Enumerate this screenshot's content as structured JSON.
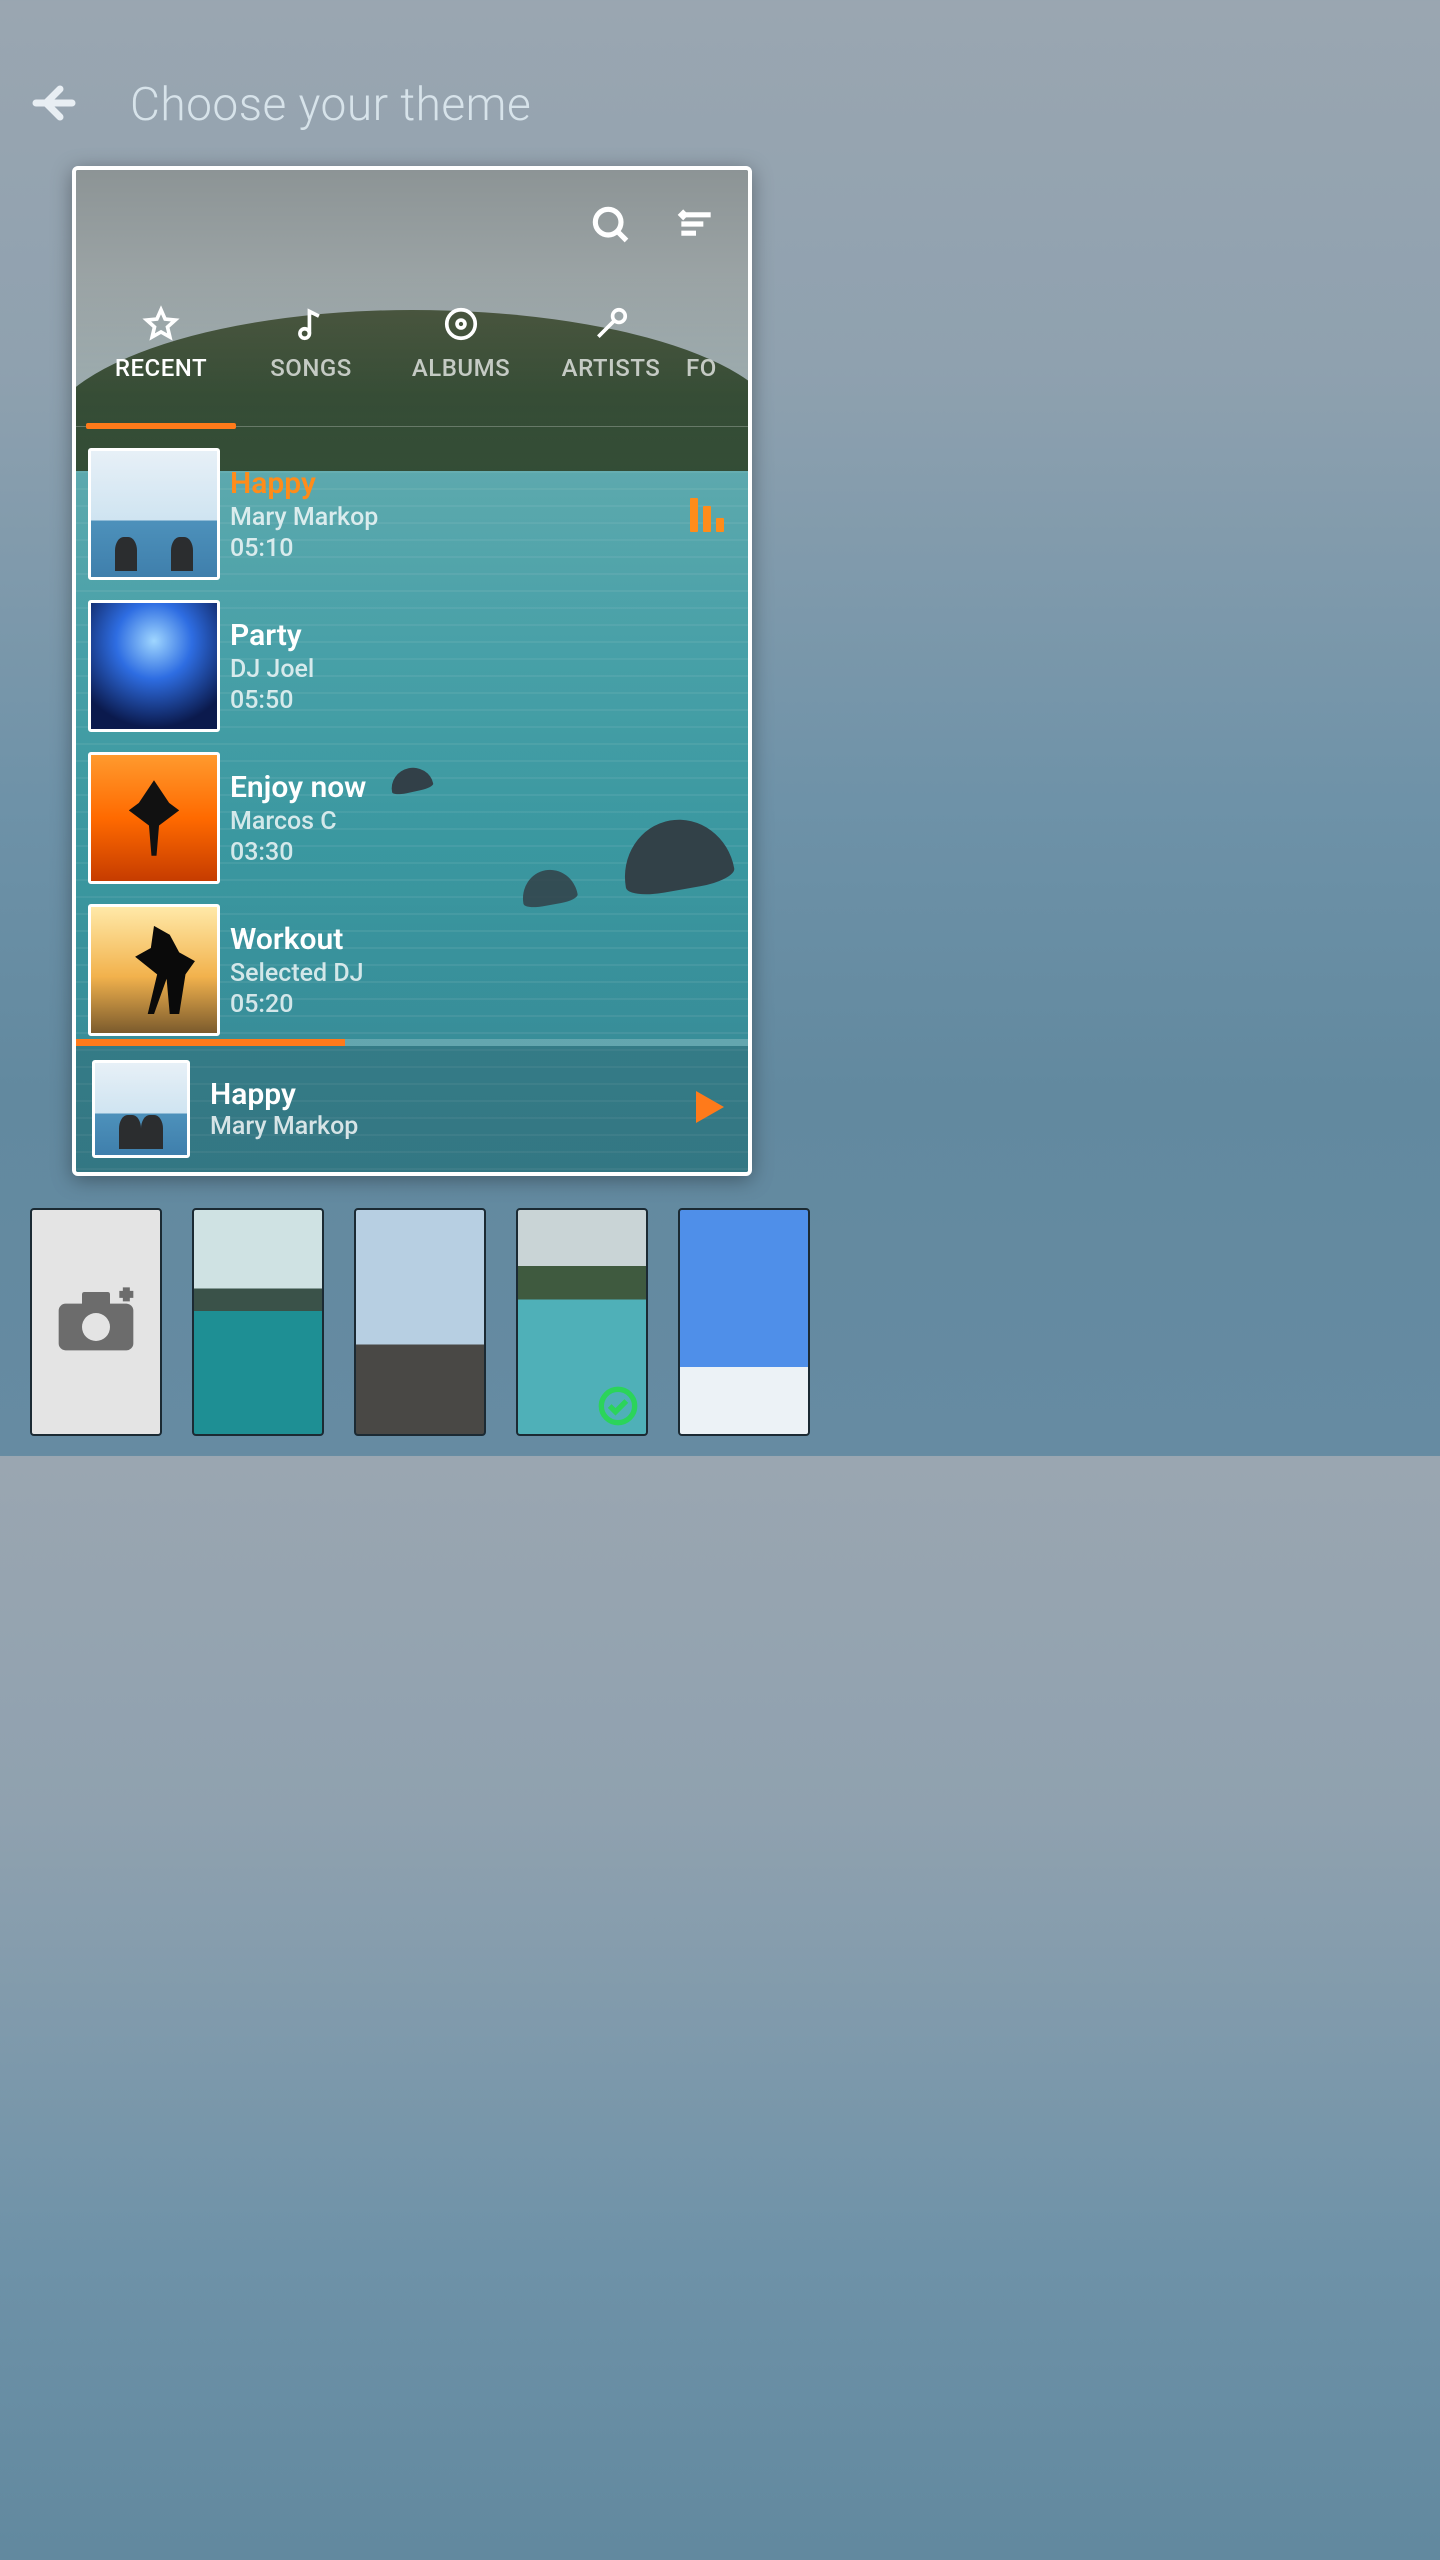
{
  "header": {
    "title": "Choose your theme"
  },
  "preview": {
    "tabs": [
      {
        "label": "RECENT",
        "icon": "star",
        "active": true
      },
      {
        "label": "SONGS",
        "icon": "note",
        "active": false
      },
      {
        "label": "ALBUMS",
        "icon": "disc",
        "active": false
      },
      {
        "label": "ARTISTS",
        "icon": "mic",
        "active": false
      },
      {
        "label": "FO",
        "icon": "",
        "active": false
      }
    ],
    "tracks": [
      {
        "title": "Happy",
        "artist": "Mary Markop",
        "duration": "05:10",
        "cover": "happy",
        "active": true
      },
      {
        "title": "Party",
        "artist": "DJ Joel",
        "duration": "05:50",
        "cover": "party",
        "active": false
      },
      {
        "title": "Enjoy now",
        "artist": "Marcos C",
        "duration": "03:30",
        "cover": "enjoy",
        "active": false
      },
      {
        "title": "Workout",
        "artist": "Selected DJ",
        "duration": "05:20",
        "cover": "workout",
        "active": false
      }
    ],
    "progress_pct": 40,
    "now_playing": {
      "title": "Happy",
      "artist": "Mary Markop",
      "cover": "happy"
    },
    "accent": "#ff7a1a"
  },
  "thumbnails": {
    "selected_index": 3,
    "items": [
      {
        "kind": "add"
      },
      {
        "kind": "img",
        "name": "cliffs-sea"
      },
      {
        "kind": "img",
        "name": "beach-rocks"
      },
      {
        "kind": "img",
        "name": "dolphins-ocean"
      },
      {
        "kind": "img",
        "name": "sky-dandelion"
      }
    ]
  }
}
